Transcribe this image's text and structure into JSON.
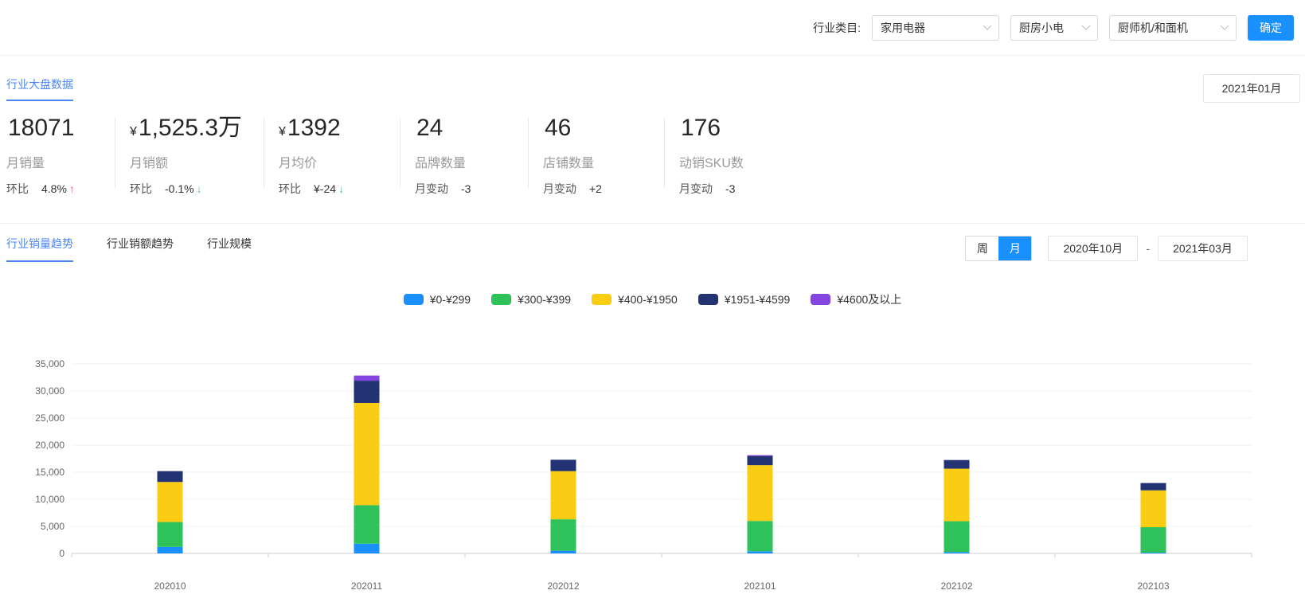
{
  "filter_bar": {
    "label": "行业类目:",
    "selects": [
      "家用电器",
      "厨房小电",
      "厨师机/和面机"
    ],
    "confirm_label": "确定"
  },
  "overview": {
    "title": "行业大盘数据",
    "date": "2021年01月",
    "kpis": [
      {
        "prefix": "",
        "value": "18071",
        "label": "月销量",
        "sub_label": "环比",
        "change": "4.8%",
        "arrow": "↑",
        "trend": "up"
      },
      {
        "prefix": "¥",
        "value": "1,525.3万",
        "label": "月销额",
        "sub_label": "环比",
        "change": "-0.1%",
        "arrow": "↓",
        "trend": "down"
      },
      {
        "prefix": "¥",
        "value": "1392",
        "label": "月均价",
        "sub_label": "环比",
        "change": "¥-24",
        "arrow": "↓",
        "trend": "down"
      },
      {
        "prefix": "",
        "value": "24",
        "label": "品牌数量",
        "sub_label": "月变动",
        "change": "-3",
        "arrow": "",
        "trend": "none"
      },
      {
        "prefix": "",
        "value": "46",
        "label": "店铺数量",
        "sub_label": "月变动",
        "change": "+2",
        "arrow": "",
        "trend": "none"
      },
      {
        "prefix": "",
        "value": "176",
        "label": "动销SKU数",
        "sub_label": "月变动",
        "change": "-3",
        "arrow": "",
        "trend": "none"
      }
    ]
  },
  "trend_section": {
    "tabs": [
      {
        "label": "行业销量趋势",
        "active": true
      },
      {
        "label": "行业销额趋势",
        "active": false
      },
      {
        "label": "行业规模",
        "active": false
      }
    ],
    "period_toggle": [
      {
        "label": "周",
        "active": false
      },
      {
        "label": "月",
        "active": true
      }
    ],
    "date_from": "2020年10月",
    "date_separator": "-",
    "date_to": "2021年03月"
  },
  "chart_data": {
    "type": "bar",
    "stacked": true,
    "title": "",
    "xlabel": "",
    "ylabel": "",
    "categories": [
      "202010",
      "202011",
      "202012",
      "202101",
      "202102",
      "202103"
    ],
    "series": [
      {
        "name": "¥0-¥299",
        "color": "#1890FF",
        "values": [
          1200,
          1800,
          500,
          400,
          250,
          150
        ]
      },
      {
        "name": "¥300-¥399",
        "color": "#2FC25B",
        "values": [
          4600,
          7100,
          5800,
          5600,
          5700,
          4700
        ]
      },
      {
        "name": "¥400-¥1950",
        "color": "#FACC14",
        "values": [
          7400,
          18900,
          8900,
          10300,
          9700,
          6800
        ]
      },
      {
        "name": "¥1951-¥4599",
        "color": "#223273",
        "values": [
          2000,
          4100,
          2100,
          1700,
          1600,
          1350
        ]
      },
      {
        "name": "¥4600及以上",
        "color": "#8543E0",
        "values": [
          0,
          950,
          0,
          150,
          0,
          0
        ]
      }
    ],
    "totals": [
      15200,
      32850,
      17300,
      18150,
      17250,
      13000
    ],
    "ylim": [
      0,
      35000
    ],
    "ytick_interval": 5000,
    "ytick_labels": [
      "0",
      "5,000",
      "10,000",
      "15,000",
      "20,000",
      "25,000",
      "30,000",
      "35,000"
    ],
    "grid": true,
    "legend_position": "top"
  },
  "icons": {
    "chevron_down": "∨",
    "trend_up_arrow": "↑",
    "trend_down_arrow": "↓"
  },
  "colors": {
    "accent": "#1890FF",
    "link_blue": "#4A86F7",
    "trend_up": "#F2637B",
    "trend_down": "#57BF8F",
    "grid_line": "#F0F0F0",
    "axis_line": "#CCCCCC"
  }
}
